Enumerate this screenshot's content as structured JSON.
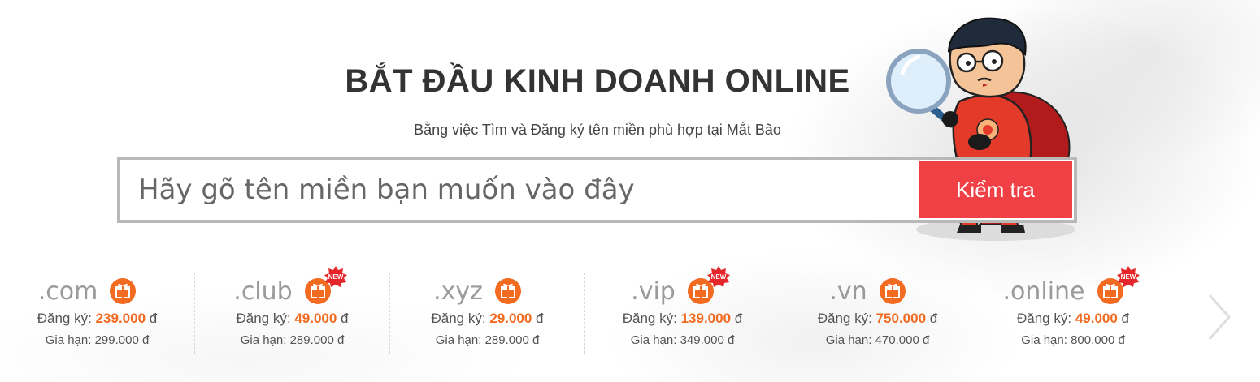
{
  "hero": {
    "title": "BẮT ĐẦU KINH DOANH ONLINE",
    "subtitle": "Bằng việc Tìm và Đăng ký tên miền phù hợp tại Mắt Bão"
  },
  "search": {
    "placeholder": "Hãy gõ tên miền bạn muốn vào đây",
    "button_label": "Kiểm tra"
  },
  "domains": [
    {
      "name": ".com",
      "register_label": "Đăng ký:",
      "register_price": "239.000",
      "currency": "đ",
      "renew_label": "Gia hạn:",
      "renew_price": "299.000 đ",
      "is_new": false
    },
    {
      "name": ".club",
      "register_label": "Đăng ký:",
      "register_price": "49.000",
      "currency": "đ",
      "renew_label": "Gia hạn:",
      "renew_price": "289.000 đ",
      "is_new": true
    },
    {
      "name": ".xyz",
      "register_label": "Đăng ký:",
      "register_price": "29.000",
      "currency": "đ",
      "renew_label": "Gia hạn:",
      "renew_price": "289.000 đ",
      "is_new": false
    },
    {
      "name": ".vip",
      "register_label": "Đăng ký:",
      "register_price": "139.000",
      "currency": "đ",
      "renew_label": "Gia hạn:",
      "renew_price": "349.000 đ",
      "is_new": true
    },
    {
      "name": ".vn",
      "register_label": "Đăng ký:",
      "register_price": "750.000",
      "currency": "đ",
      "renew_label": "Gia hạn:",
      "renew_price": "470.000 đ",
      "is_new": false
    },
    {
      "name": ".online",
      "register_label": "Đăng ký:",
      "register_price": "49.000",
      "currency": "đ",
      "renew_label": "Gia hạn:",
      "renew_price": "800.000 đ",
      "is_new": true
    }
  ],
  "badges": {
    "new_text": "NEW"
  },
  "icons": {
    "gift": "gift-icon",
    "new": "new-badge-icon",
    "next": "chevron-right-icon",
    "mascot": "mascot-magnifier-illustration"
  },
  "colors": {
    "accent_red": "#f04046",
    "price_orange": "#f26b21",
    "gift_orange": "#f26b21",
    "text_dark": "#333333"
  }
}
